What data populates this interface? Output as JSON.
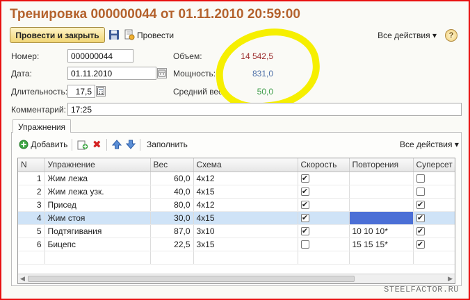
{
  "title": "Тренировка 000000044 от 01.11.2010 20:59:00",
  "toolbar": {
    "post_close_label": "Провести и закрыть",
    "post_label": "Провести",
    "all_actions_label": "Все действия",
    "help_label": "?"
  },
  "form": {
    "number_label": "Номер:",
    "number_value": "000000044",
    "date_label": "Дата:",
    "date_value": "01.11.2010",
    "duration_label": "Длительность:",
    "duration_value": "17,5",
    "comment_label": "Комментарий:",
    "comment_value": "17:25",
    "volume_label": "Объем:",
    "volume_value": "14 542,5",
    "power_label": "Мощность:",
    "power_value": "831,0",
    "avg_weight_label": "Средний вес:",
    "avg_weight_value": "50,0"
  },
  "colors": {
    "volume": "#9b2b2b",
    "power": "#4d6fa8",
    "avg_weight": "#3f9e4a"
  },
  "tabs": {
    "exercises_label": "Упражнения"
  },
  "table_toolbar": {
    "add_label": "Добавить",
    "fill_label": "Заполнить",
    "all_actions_label": "Все действия"
  },
  "table": {
    "columns": [
      "N",
      "Упражнение",
      "Вес",
      "Схема",
      "Скорость",
      "Повторения",
      "Суперсет"
    ],
    "rows": [
      {
        "n": "1",
        "exercise": "Жим лежа",
        "weight": "60,0",
        "scheme": "4x12",
        "speed": true,
        "reps": "",
        "superset": false
      },
      {
        "n": "2",
        "exercise": "Жим лежа узк.",
        "weight": "40,0",
        "scheme": "4x15",
        "speed": true,
        "reps": "",
        "superset": false
      },
      {
        "n": "3",
        "exercise": "Присед",
        "weight": "80,0",
        "scheme": "4x12",
        "speed": true,
        "reps": "",
        "superset": true
      },
      {
        "n": "4",
        "exercise": "Жим стоя",
        "weight": "30,0",
        "scheme": "4x15",
        "speed": true,
        "reps": "",
        "superset": true
      },
      {
        "n": "5",
        "exercise": "Подтягивания",
        "weight": "87,0",
        "scheme": "3x10",
        "speed": true,
        "reps": "10 10 10*",
        "superset": true
      },
      {
        "n": "6",
        "exercise": "Бицепс",
        "weight": "22,5",
        "scheme": "3x15",
        "speed": false,
        "reps": "15 15 15*",
        "superset": true
      }
    ],
    "selected_row_index": 3
  },
  "watermark": "STEELFACTOR.RU"
}
